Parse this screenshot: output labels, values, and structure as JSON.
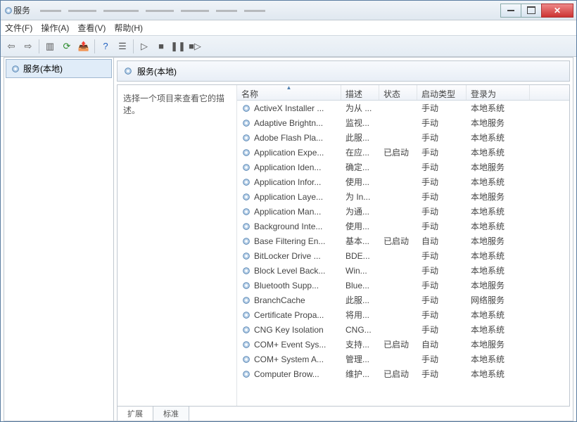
{
  "title": "服务",
  "menu": {
    "file": "文件(F)",
    "action": "操作(A)",
    "view": "查看(V)",
    "help": "帮助(H)"
  },
  "left": {
    "root": "服务(本地)"
  },
  "header": "服务(本地)",
  "desc": "选择一个项目来查看它的描述。",
  "cols": {
    "name": "名称",
    "desc": "描述",
    "status": "状态",
    "startup": "启动类型",
    "logon": "登录为"
  },
  "tabs": {
    "ext": "扩展",
    "std": "标准"
  },
  "rows": [
    {
      "name": "ActiveX Installer ...",
      "desc": "为从 ...",
      "status": "",
      "startup": "手动",
      "logon": "本地系统"
    },
    {
      "name": "Adaptive Brightn...",
      "desc": "监视...",
      "status": "",
      "startup": "手动",
      "logon": "本地服务"
    },
    {
      "name": "Adobe Flash Pla...",
      "desc": "此服...",
      "status": "",
      "startup": "手动",
      "logon": "本地系统"
    },
    {
      "name": "Application Expe...",
      "desc": "在应...",
      "status": "已启动",
      "startup": "手动",
      "logon": "本地系统"
    },
    {
      "name": "Application Iden...",
      "desc": "确定...",
      "status": "",
      "startup": "手动",
      "logon": "本地服务"
    },
    {
      "name": "Application Infor...",
      "desc": "使用...",
      "status": "",
      "startup": "手动",
      "logon": "本地系统"
    },
    {
      "name": "Application Laye...",
      "desc": "为 In...",
      "status": "",
      "startup": "手动",
      "logon": "本地服务"
    },
    {
      "name": "Application Man...",
      "desc": "为通...",
      "status": "",
      "startup": "手动",
      "logon": "本地系统"
    },
    {
      "name": "Background Inte...",
      "desc": "使用...",
      "status": "",
      "startup": "手动",
      "logon": "本地系统"
    },
    {
      "name": "Base Filtering En...",
      "desc": "基本...",
      "status": "已启动",
      "startup": "自动",
      "logon": "本地服务"
    },
    {
      "name": "BitLocker Drive ...",
      "desc": "BDE...",
      "status": "",
      "startup": "手动",
      "logon": "本地系统"
    },
    {
      "name": "Block Level Back...",
      "desc": "Win...",
      "status": "",
      "startup": "手动",
      "logon": "本地系统"
    },
    {
      "name": "Bluetooth Supp...",
      "desc": "Blue...",
      "status": "",
      "startup": "手动",
      "logon": "本地服务"
    },
    {
      "name": "BranchCache",
      "desc": "此服...",
      "status": "",
      "startup": "手动",
      "logon": "网络服务"
    },
    {
      "name": "Certificate Propa...",
      "desc": "将用...",
      "status": "",
      "startup": "手动",
      "logon": "本地系统"
    },
    {
      "name": "CNG Key Isolation",
      "desc": "CNG...",
      "status": "",
      "startup": "手动",
      "logon": "本地系统"
    },
    {
      "name": "COM+ Event Sys...",
      "desc": "支持...",
      "status": "已启动",
      "startup": "自动",
      "logon": "本地服务"
    },
    {
      "name": "COM+ System A...",
      "desc": "管理...",
      "status": "",
      "startup": "手动",
      "logon": "本地系统"
    },
    {
      "name": "Computer Brow...",
      "desc": "维护...",
      "status": "已启动",
      "startup": "手动",
      "logon": "本地系统"
    }
  ]
}
